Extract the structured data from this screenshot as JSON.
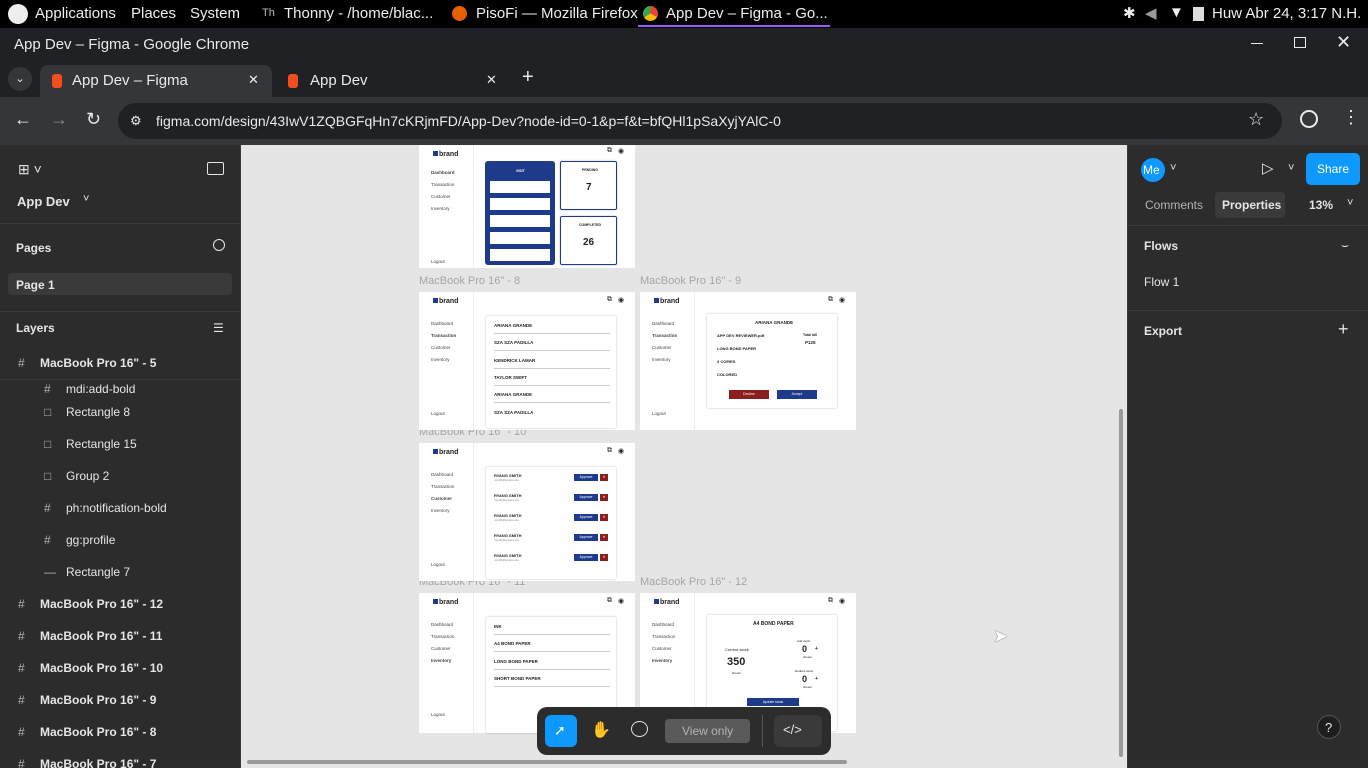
{
  "os_bar": {
    "applications": "Applications",
    "places": "Places",
    "system": "System",
    "task1": "Thonny  -  /home/blac...",
    "task2": "PisoFi — Mozilla Firefox",
    "task3": "App Dev – Figma - Go...",
    "clock": "Huw Abr 24,  3:17 N.H."
  },
  "window": {
    "title": "App Dev – Figma - Google Chrome"
  },
  "tabs": [
    {
      "label": "App Dev – Figma",
      "active": true
    },
    {
      "label": "App Dev",
      "active": false
    }
  ],
  "address_bar": {
    "url": "figma.com/design/43IwV1ZQBGFqHn7cKRjmFD/App-Dev?node-id=0-1&p=f&t=bfQHl1pSaXyjYAlC-0"
  },
  "figma_left": {
    "file_name": "App Dev",
    "pages_heading": "Pages",
    "pages": [
      "Page 1"
    ],
    "layers_heading": "Layers",
    "layers": [
      {
        "label": "MacBook Pro 16\" - 5",
        "icon": "frame-icon",
        "bold": true
      },
      {
        "label": "mdi:add-bold",
        "icon": "frame-icon",
        "bold": false
      },
      {
        "label": "Rectangle 8",
        "icon": "rectangle-icon",
        "bold": false
      },
      {
        "label": "Rectangle 15",
        "icon": "rectangle-icon",
        "bold": false
      },
      {
        "label": "Group 2",
        "icon": "group-icon",
        "bold": false
      },
      {
        "label": "ph:notification-bold",
        "icon": "frame-icon",
        "bold": false
      },
      {
        "label": "gg:profile",
        "icon": "frame-icon",
        "bold": false
      },
      {
        "label": "Rectangle 7",
        "icon": "line-icon",
        "bold": false
      },
      {
        "label": "MacBook Pro 16\" - 12",
        "icon": "frame-icon",
        "bold": true
      },
      {
        "label": "MacBook Pro 16\" - 11",
        "icon": "frame-icon",
        "bold": true
      },
      {
        "label": "MacBook Pro 16\" - 10",
        "icon": "frame-icon",
        "bold": true
      },
      {
        "label": "MacBook Pro 16\" - 9",
        "icon": "frame-icon",
        "bold": true
      },
      {
        "label": "MacBook Pro 16\" - 8",
        "icon": "frame-icon",
        "bold": true
      },
      {
        "label": "MacBook Pro 16\" - 7",
        "icon": "frame-icon",
        "bold": true
      }
    ]
  },
  "figma_right": {
    "avatar": "Me",
    "share": "Share",
    "tab_comments": "Comments",
    "tab_properties": "Properties",
    "zoom": "13%",
    "flows_heading": "Flows",
    "flow_item": "Flow 1",
    "export_heading": "Export"
  },
  "bottom_toolbar": {
    "view_only": "View only"
  },
  "canvas": {
    "labels": {
      "f8": "MacBook Pro 16\" - 8",
      "f9": "MacBook Pro 16\" - 9",
      "f10": "MacBook Pro 16\" - 10",
      "f11": "MacBook Pro 16\" - 11",
      "f12": "MacBook Pro 16\" - 12"
    },
    "mock": {
      "brand": "brand",
      "nav": [
        "Dashboard",
        "Transaction",
        "Customer",
        "Inventory"
      ],
      "logout": "Logout",
      "top_panel": {
        "visit": "VISIT",
        "pending_label": "PENDING",
        "pending_value": "7",
        "completed_label": "COMPLETED",
        "completed_value": "26"
      },
      "f8_names": [
        "ARIANA GRANDE",
        "SZA SZA PADILLA",
        "KENDRICK LAMAR",
        "TAYLOR SWIFT",
        "ARIANA GRANDE",
        "SZA SZA PADILLA"
      ],
      "f9": {
        "name": "ARIANA GRANDE",
        "file": "APP DEV REVIEWER.pdf",
        "total_label": "Total bill",
        "total_value": "P125",
        "paper": "LONG BOND PAPER",
        "copies": "3 COPIES",
        "colored": "COLORED",
        "decline": "Decline",
        "accept": "Accept"
      },
      "f10_name": "RYANG SMITH",
      "f10_email": "rsmith@gmail.com",
      "f10_approve": "Approve",
      "f11_items": [
        "INK",
        "A4 BOND PAPER",
        "LONG BOND PAPER",
        "SHORT BOND PAPER"
      ],
      "f12": {
        "title": "A4 BOND PAPER",
        "current_label": "Current stock",
        "current_value": "350",
        "current_unit": "sheets",
        "add_label": "Add stock",
        "add_value": "0",
        "reduce_label": "Reduce stock",
        "reduce_value": "0",
        "unit": "sheets",
        "update": "Update stock"
      }
    }
  }
}
